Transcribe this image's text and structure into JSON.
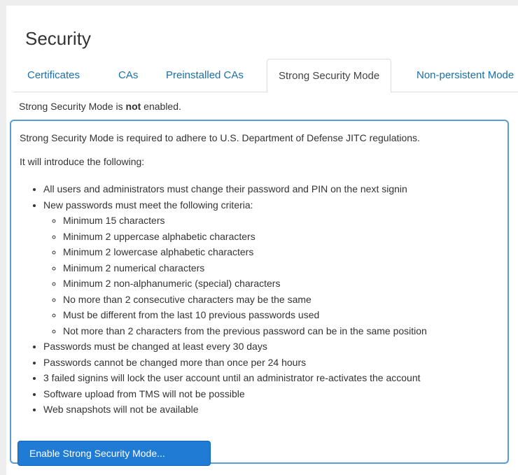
{
  "page": {
    "title": "Security"
  },
  "tabs": [
    {
      "label": "Certificates",
      "active": false
    },
    {
      "label": "CAs",
      "active": false
    },
    {
      "label": "Preinstalled CAs",
      "active": false
    },
    {
      "label": "Strong Security Mode",
      "active": true
    },
    {
      "label": "Non-persistent Mode",
      "active": false
    }
  ],
  "status": {
    "prefix": "Strong Security Mode is ",
    "emphasis": "not",
    "suffix": " enabled."
  },
  "info": {
    "intro": "Strong Security Mode is required to adhere to U.S. Department of Defense JITC regulations.",
    "lead": "It will introduce the following:",
    "items": [
      "All users and administrators must change their password and PIN on the next signin",
      "New passwords must meet the following criteria:",
      "Passwords must be changed at least every 30 days",
      "Passwords cannot be changed more than once per 24 hours",
      "3 failed signins will lock the user account until an administrator re-activates the account",
      "Software upload from TMS will not be possible",
      "Web snapshots will not be available"
    ],
    "criteria": [
      "Minimum 15 characters",
      "Minimum 2 uppercase alphabetic characters",
      "Minimum 2 lowercase alphabetic characters",
      "Minimum 2 numerical characters",
      "Minimum 2 non-alphanumeric (special) characters",
      "No more than 2 consecutive characters may be the same",
      "Must be different from the last 10 previous passwords used",
      "Not more than 2 characters from the previous password can be in the same position"
    ]
  },
  "actions": {
    "enable_label": "Enable Strong Security Mode..."
  },
  "colors": {
    "link": "#1a6fa8",
    "accent": "#1f7bd4",
    "box_border": "#5b9bd5"
  }
}
